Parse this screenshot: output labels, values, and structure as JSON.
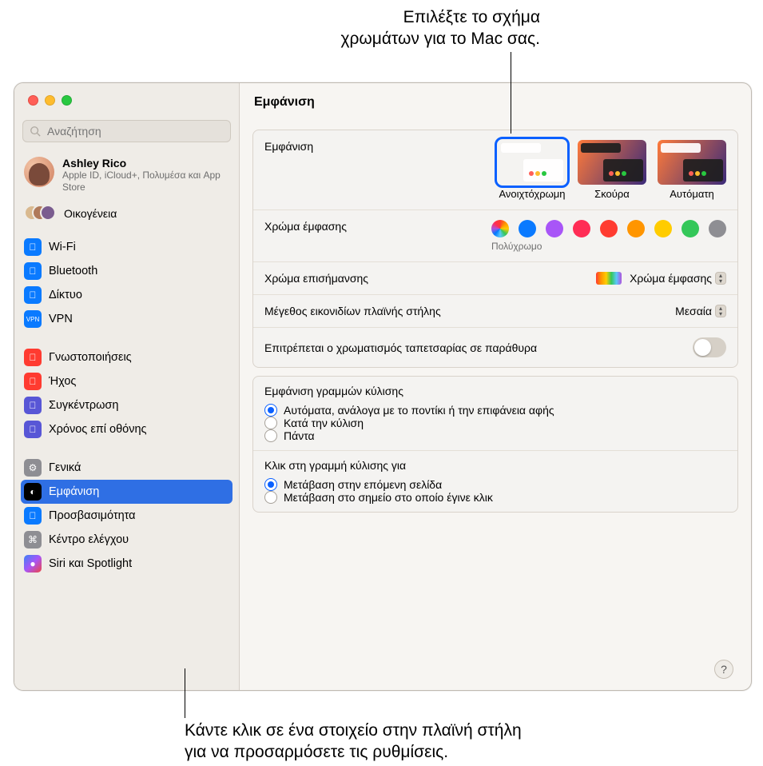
{
  "callouts": {
    "top": "Επιλέξτε το σχήμα χρωμάτων για το Mac σας.",
    "bottom": "Κάντε κλικ σε ένα στοιχείο στην πλαϊνή στήλη για να προσαρμόσετε τις ρυθμίσεις."
  },
  "search": {
    "placeholder": "Αναζήτηση"
  },
  "account": {
    "name": "Ashley Rico",
    "sub": "Apple ID, iCloud+, Πολυμέσα και App Store"
  },
  "family_label": "Οικογένεια",
  "sidebar": {
    "items": [
      {
        "label": "Wi-Fi",
        "icon": "wifi-icon",
        "color": "i-blue"
      },
      {
        "label": "Bluetooth",
        "icon": "bluetooth-icon",
        "color": "i-blue"
      },
      {
        "label": "Δίκτυο",
        "icon": "network-icon",
        "color": "i-blue"
      },
      {
        "label": "VPN",
        "icon": "vpn-icon",
        "color": "i-blue"
      },
      {
        "label": "Γνωστοποιήσεις",
        "icon": "bell-icon",
        "color": "i-red"
      },
      {
        "label": "Ήχος",
        "icon": "sound-icon",
        "color": "i-red"
      },
      {
        "label": "Συγκέντρωση",
        "icon": "moon-icon",
        "color": "i-purple"
      },
      {
        "label": "Χρόνος επί οθόνης",
        "icon": "hourglass-icon",
        "color": "i-purple"
      },
      {
        "label": "Γενικά",
        "icon": "gear-icon",
        "color": "i-gray"
      },
      {
        "label": "Εμφάνιση",
        "icon": "appearance-icon",
        "color": "i-black"
      },
      {
        "label": "Προσβασιμότητα",
        "icon": "accessibility-icon",
        "color": "i-blue"
      },
      {
        "label": "Κέντρο ελέγχου",
        "icon": "control-center-icon",
        "color": "i-gray"
      },
      {
        "label": "Siri και Spotlight",
        "icon": "siri-icon",
        "color": "i-grad"
      }
    ]
  },
  "title": "Εμφάνιση",
  "appearance": {
    "label": "Εμφάνιση",
    "options": [
      "Ανοιχτόχρωμη",
      "Σκούρα",
      "Αυτόματη"
    ],
    "selected": 0
  },
  "accent": {
    "label": "Χρώμα έμφασης",
    "selected_label": "Πολύχρωμο",
    "colors": [
      "multi",
      "#0a7aff",
      "#a855f7",
      "#ff2d55",
      "#ff3b30",
      "#ff9500",
      "#ffcc00",
      "#34c759",
      "#8e8e93"
    ]
  },
  "highlight": {
    "label": "Χρώμα επισήμανσης",
    "value": "Χρώμα έμφασης"
  },
  "sidebar_size": {
    "label": "Μέγεθος εικονιδίων πλαϊνής στήλης",
    "value": "Μεσαία"
  },
  "tinting": {
    "label": "Επιτρέπεται ο χρωματισμός ταπετσαρίας σε παράθυρα",
    "on": false
  },
  "scrollbars": {
    "title": "Εμφάνιση γραμμών κύλισης",
    "options": [
      "Αυτόματα, ανάλογα με το ποντίκι ή την επιφάνεια αφής",
      "Κατά την κύλιση",
      "Πάντα"
    ],
    "selected": 0
  },
  "scrollclick": {
    "title": "Κλικ στη γραμμή κύλισης για",
    "options": [
      "Μετάβαση στην επόμενη σελίδα",
      "Μετάβαση στο σημείο στο οποίο έγινε κλικ"
    ],
    "selected": 0
  }
}
